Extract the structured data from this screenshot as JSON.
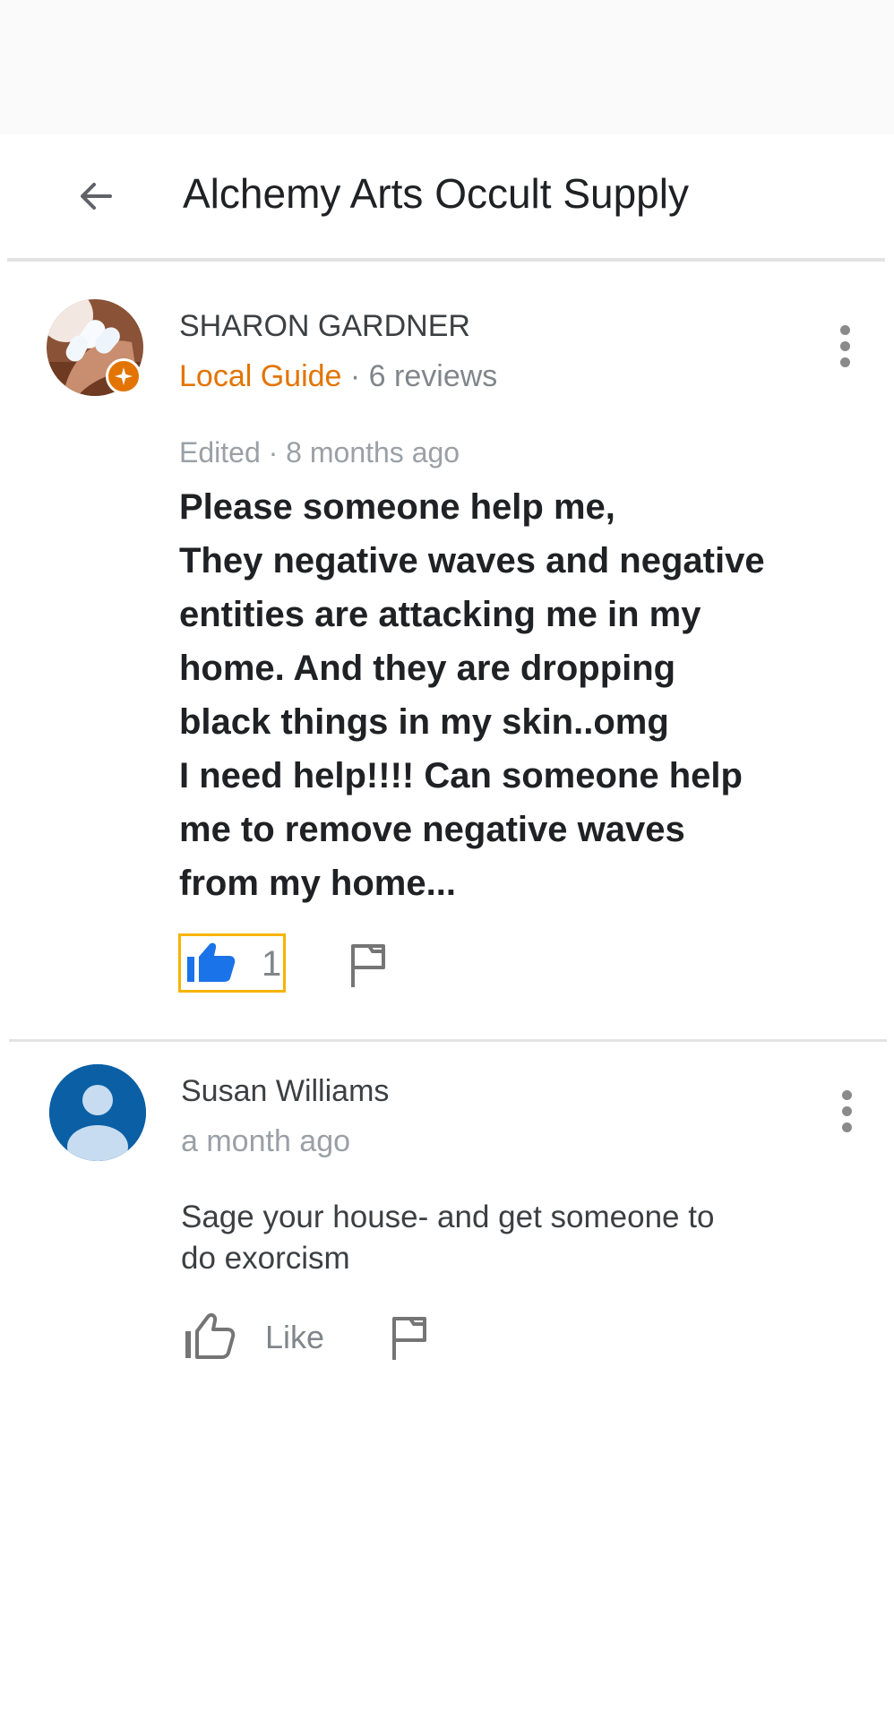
{
  "header": {
    "back_icon": "arrow-back-icon",
    "title": "Alchemy Arts Occult Supply"
  },
  "review": {
    "author": "SHARON GARDNER",
    "guide_label": "Local Guide",
    "reviews_count": " · 6 reviews",
    "date": "Edited · 8 months ago",
    "text_lines": [
      "Please someone help me,",
      "They negative waves and negative",
      "entities are attacking me in my",
      "home. And they are dropping",
      "black things in my skin..omg",
      "I need help!!!! Can someone help",
      "me to remove negative waves",
      "from my home..."
    ],
    "like_count": "1",
    "like_icon": "thumbs-up-filled-icon",
    "flag_icon": "flag-icon",
    "more_icon": "more-vert-icon"
  },
  "reply": {
    "author": "Susan Williams",
    "date": "a month ago",
    "text_lines": [
      "Sage your house- and get someone to",
      "do exorcism"
    ],
    "like_label": "Like",
    "like_icon": "thumbs-up-outline-icon",
    "flag_icon": "flag-icon",
    "more_icon": "more-vert-icon"
  },
  "colors": {
    "accent_orange": "#e37400",
    "like_blue": "#1a73e8",
    "highlight_yellow": "#f6b400",
    "avatar_blue": "#0b5fa5"
  }
}
